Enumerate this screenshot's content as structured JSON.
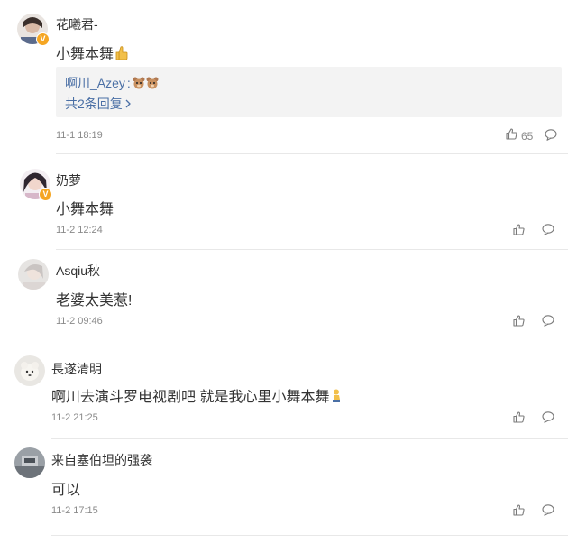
{
  "comments": [
    {
      "username": "花曦君-",
      "content": "小舞本舞",
      "content_emoji": "thumbs-up-emoji",
      "reply": {
        "author": "啊川_Azey",
        "sep": ":",
        "emoji": "bear-face-emoji",
        "more": "共2条回复"
      },
      "timestamp": "11-1 18:19",
      "likes": "65",
      "verified": true
    },
    {
      "username": "奶萝",
      "content": "小舞本舞",
      "timestamp": "11-2 12:24",
      "verified": true
    },
    {
      "username": "Asqiu秋",
      "content": "老婆太美惹!",
      "timestamp": "11-2 09:46"
    },
    {
      "username": "長遂清明",
      "content": "啊川去演斗罗电视剧吧 就是我心里小舞本舞",
      "content_emoji": "kneeling-figure-emoji",
      "timestamp": "11-2 21:25"
    },
    {
      "username": "来自塞伯坦的强袭",
      "content": "可以",
      "timestamp": "11-2 17:15"
    }
  ],
  "colors": {
    "link": "#4a6fa5",
    "meta": "#8a8a8a",
    "divider": "#e8e8e8",
    "verified_badge": "#f5a623",
    "reply_bg": "#f3f3f3"
  }
}
